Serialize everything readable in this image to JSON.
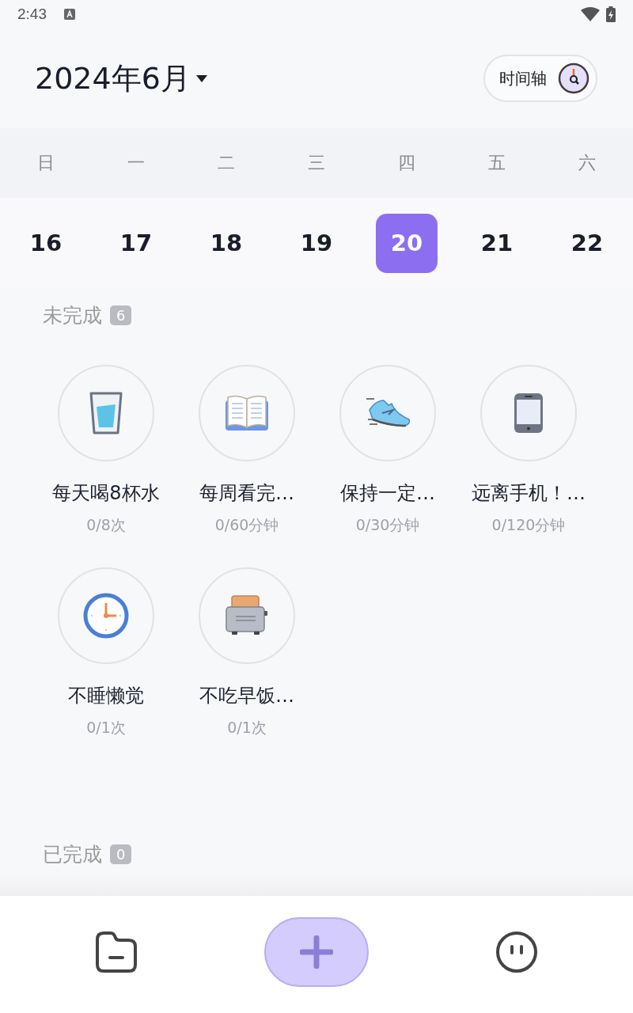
{
  "status_bar": {
    "time": "2:43"
  },
  "header": {
    "month": "2024年6月",
    "timeline_button": "时间轴"
  },
  "weekdays": [
    "日",
    "一",
    "二",
    "三",
    "四",
    "五",
    "六"
  ],
  "dates": [
    {
      "day": "16",
      "selected": false
    },
    {
      "day": "17",
      "selected": false
    },
    {
      "day": "18",
      "selected": false
    },
    {
      "day": "19",
      "selected": false
    },
    {
      "day": "20",
      "selected": true
    },
    {
      "day": "21",
      "selected": false
    },
    {
      "day": "22",
      "selected": false
    }
  ],
  "pending": {
    "title": "未完成",
    "count": "6",
    "habits": [
      {
        "kind": "glass",
        "name": "每天喝8杯水",
        "progress": "0/8次"
      },
      {
        "kind": "book",
        "name": "每周看完…",
        "progress": "0/60分钟"
      },
      {
        "kind": "shoe",
        "name": "保持一定…",
        "progress": "0/30分钟"
      },
      {
        "kind": "phone",
        "name": "远离手机！…",
        "progress": "0/120分钟"
      },
      {
        "kind": "clock",
        "name": "不睡懒觉",
        "progress": "0/1次"
      },
      {
        "kind": "toaster",
        "name": "不吃早饭…",
        "progress": "0/1次"
      }
    ]
  },
  "done": {
    "title": "已完成",
    "count": "0"
  }
}
